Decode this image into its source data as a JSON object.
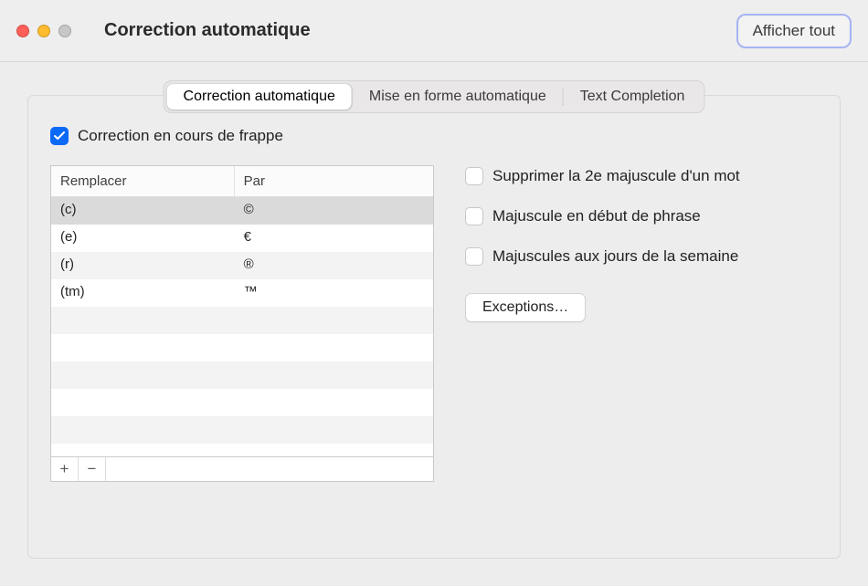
{
  "window": {
    "title": "Correction automatique",
    "show_all_label": "Afficher tout"
  },
  "tabs": [
    {
      "label": "Correction automatique",
      "selected": true
    },
    {
      "label": "Mise en forme automatique",
      "selected": false
    },
    {
      "label": "Text Completion",
      "selected": false
    }
  ],
  "autocorrect": {
    "typing_replace_label": "Correction en cours de frappe",
    "typing_replace_checked": true,
    "table": {
      "header_replace": "Remplacer",
      "header_by": "Par",
      "rows": [
        {
          "replace": "(c)",
          "by": "©"
        },
        {
          "replace": "(e)",
          "by": "€"
        },
        {
          "replace": "(r)",
          "by": "®"
        },
        {
          "replace": "(tm)",
          "by": "™"
        }
      ],
      "selected_row": 0
    },
    "buttons": {
      "add": "+",
      "remove": "−"
    },
    "options": {
      "double_cap_label": "Supprimer la 2e majuscule d'un mot",
      "double_cap_checked": false,
      "sentence_cap_label": "Majuscule en début de phrase",
      "sentence_cap_checked": false,
      "days_cap_label": "Majuscules aux jours de la semaine",
      "days_cap_checked": false,
      "exceptions_label": "Exceptions…"
    }
  }
}
